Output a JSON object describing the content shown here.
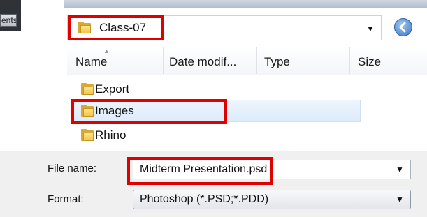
{
  "window_fragment": {
    "label": "ents"
  },
  "location": {
    "folder": "Class-07",
    "dropdown_icon": "chevron-down-icon",
    "back_icon": "back-arrow-icon"
  },
  "file_list": {
    "columns": [
      "Name",
      "Date modif...",
      "Type",
      "Size"
    ],
    "items": [
      {
        "name": "Export"
      },
      {
        "name": "Images"
      },
      {
        "name": "Rhino"
      }
    ]
  },
  "form": {
    "file_name_label": "File name:",
    "file_name_value": "Midterm Presentation.psd",
    "format_label": "Format:",
    "format_value": "Photoshop (*.PSD;*.PDD)"
  },
  "colors": {
    "highlight": "#e00000",
    "folder": "#f2c64c",
    "selection": "#dcebfb"
  }
}
